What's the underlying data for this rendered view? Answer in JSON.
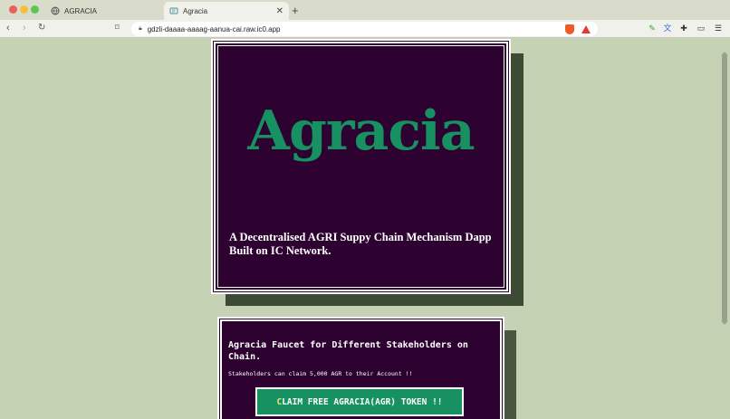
{
  "browser": {
    "tabs": [
      {
        "label": "AGRACIA"
      },
      {
        "label": "Agracia"
      }
    ],
    "new_tab": "+",
    "url": "gdzli-daaaa-aaaag-aanua-cai.raw.ic0.app"
  },
  "hero": {
    "logo_text": "Agracia",
    "tagline": "A Decentralised AGRI Suppy Chain Mechanism Dapp Built on IC Network."
  },
  "faucet": {
    "title": "Agracia Faucet for Different Stakeholders on Chain.",
    "subtitle": "Stakeholders can claim 5,000 AGR to their Account !!",
    "button_first_letter": "C",
    "button_rest": "LAIM FREE AGRACIA(AGR) TOKEN !!"
  },
  "colors": {
    "background": "#c5d2b4",
    "card": "#2d0231",
    "brand_green": "#189162"
  }
}
